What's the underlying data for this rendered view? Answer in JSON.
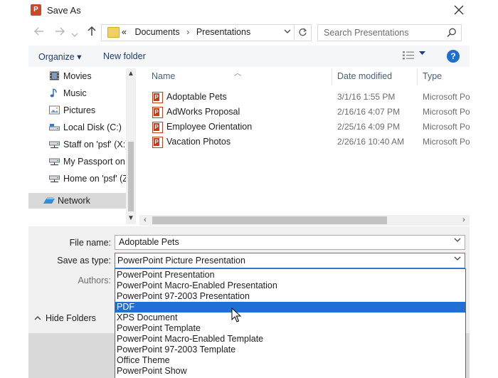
{
  "window": {
    "title": "Save As"
  },
  "address": {
    "breadcrumb_prefix": "«",
    "path": [
      "Documents",
      "Presentations"
    ]
  },
  "search": {
    "placeholder": "Search Presentations"
  },
  "toolbar": {
    "organize_label": "Organize ▾",
    "new_folder_label": "New folder",
    "help_label": "?"
  },
  "nav": {
    "items": [
      {
        "label": "Movies",
        "icon": "movies-icon"
      },
      {
        "label": "Music",
        "icon": "music-icon"
      },
      {
        "label": "Pictures",
        "icon": "pictures-icon"
      },
      {
        "label": "Local Disk (C:)",
        "icon": "local-disk-icon"
      },
      {
        "label": "Staff on 'psf' (X:)",
        "icon": "network-drive-icon"
      },
      {
        "label": "My Passport on",
        "icon": "network-drive-icon"
      },
      {
        "label": "Home on 'psf' (Z:)",
        "icon": "network-drive-icon"
      },
      {
        "label": "Network",
        "icon": "network-icon",
        "selected": true
      }
    ]
  },
  "files": {
    "columns": [
      "Name",
      "Date modified",
      "Type"
    ],
    "rows": [
      {
        "name": "Adoptable Pets",
        "date": "3/1/16 1:55 PM",
        "type": "Microsoft Po"
      },
      {
        "name": "AdWorks Proposal",
        "date": "2/16/16 4:07 PM",
        "type": "Microsoft Po"
      },
      {
        "name": "Employee Orientation",
        "date": "2/25/16 4:09 PM",
        "type": "Microsoft Po"
      },
      {
        "name": "Vacation Photos",
        "date": "2/26/16 10:40 AM",
        "type": "Microsoft Po"
      }
    ]
  },
  "form": {
    "file_name_label": "File name:",
    "file_name_value": "Adoptable Pets",
    "save_type_label": "Save as type:",
    "save_type_value": "PowerPoint Picture Presentation",
    "authors_label": "Authors:",
    "hide_folders_label": "Hide Folders"
  },
  "dropdown": {
    "options": [
      "PowerPoint Presentation",
      "PowerPoint Macro-Enabled Presentation",
      "PowerPoint 97-2003 Presentation",
      "PDF",
      "XPS Document",
      "PowerPoint Template",
      "PowerPoint Macro-Enabled Template",
      "PowerPoint 97-2003 Template",
      "Office Theme",
      "PowerPoint Show"
    ],
    "highlighted_index": 3
  },
  "colors": {
    "accent": "#1e6fd6",
    "link": "#1e3c73",
    "app_icon": "#c9472a"
  }
}
